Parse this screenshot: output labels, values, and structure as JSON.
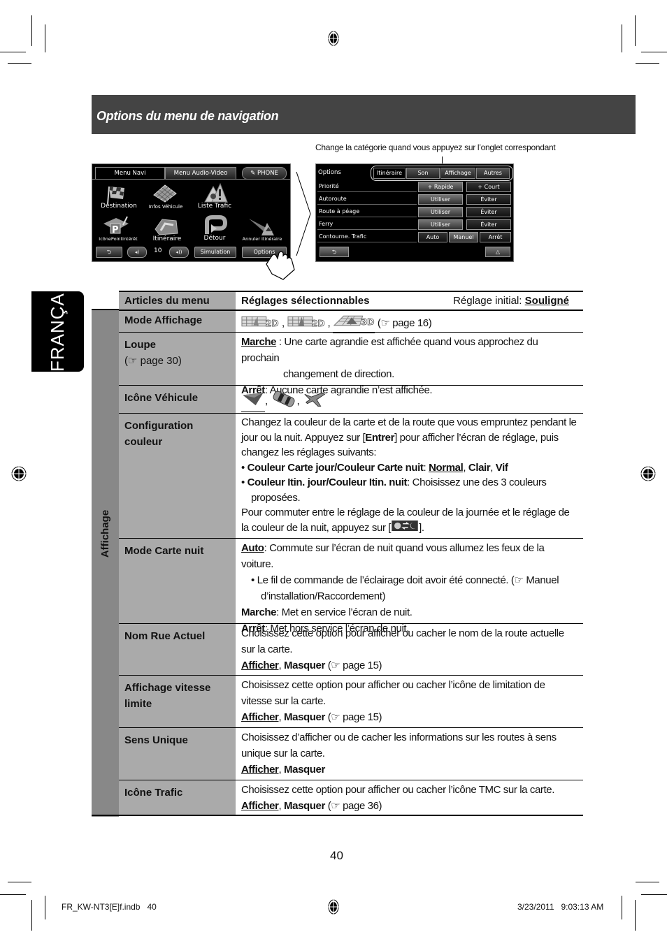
{
  "section": {
    "title": "Options du menu de navigation"
  },
  "caption": "Change la catégorie quand vous appuyez sur l’onglet correspondant",
  "screen_navi": {
    "tabs": [
      "Menu Navi",
      "Menu Audio-Video",
      "PHONE"
    ],
    "items": [
      {
        "label": "Destination",
        "icon": "checkered-flag-icon"
      },
      {
        "label": "Infos Véhicule",
        "icon": "map-grid-icon"
      },
      {
        "label": "Liste Trafic",
        "icon": "traffic-warning-icon"
      },
      {
        "label": "IcônePointIntérêt",
        "icon": "poi-parking-icon"
      },
      {
        "label": "Itinéraire",
        "icon": "route-map-icon"
      },
      {
        "label": "Détour",
        "icon": "detour-arrow-icon"
      },
      {
        "label": "Annuler Itinéraire",
        "icon": "cancel-route-icon"
      }
    ],
    "bottom": {
      "volume": "10",
      "simulation": "Simulation",
      "options": "Options"
    }
  },
  "screen_options": {
    "title": "Options",
    "tabs": [
      "Itinéraire",
      "Son",
      "Affichage",
      "Autres"
    ],
    "rows": [
      {
        "label": "Priorité",
        "buttons": [
          "+ Rapide",
          "+ Court"
        ]
      },
      {
        "label": "Autoroute",
        "buttons": [
          "Utiliser",
          "Éviter"
        ]
      },
      {
        "label": "Route à péage",
        "buttons": [
          "Utiliser",
          "Éviter"
        ]
      },
      {
        "label": "Ferry",
        "buttons": [
          "Utiliser",
          "Éviter"
        ]
      },
      {
        "label": "Contourne. Trafic",
        "buttons": [
          "Auto",
          "Manuel",
          "Arrêt"
        ]
      }
    ]
  },
  "language_tab": "FRANÇAIS",
  "table": {
    "col1": "Articles du menu",
    "col2": "Réglages sélectionnables",
    "initial_label": "Réglage initial:",
    "initial_value": "Souligné",
    "group": "Affichage",
    "rows": {
      "mode_affichage": {
        "name": "Mode Affichage",
        "ref": "(☞ page 16)",
        "options": [
          "2D North-up",
          "2D Heading-up",
          "3D"
        ]
      },
      "loupe": {
        "name": "Loupe",
        "ref": "(☞ page 30)",
        "l1_b": "Marche",
        "l1": " : Une carte agrandie est affichée quand vous approchez du prochain",
        "l1b": "changement de direction.",
        "l2_b": "Arrêt",
        "l2": ": Aucune carte agrandie n’est affichée."
      },
      "icone_vehicule": {
        "name": "Icône Véhicule",
        "options": [
          "arrow",
          "car",
          "jet"
        ]
      },
      "config_couleur": {
        "name": "Configuration couleur",
        "p1a": "Changez la couleur de la carte et de la route que vous empruntez pendant le jour ou la nuit. Appuyez sur [",
        "p1b": "Entrer",
        "p1c": "] pour afficher l’écran de réglage, puis changez les réglages suivants:",
        "b1_label": "Couleur Carte jour/Couleur Carte nuit",
        "b1_opt1": "Normal",
        "b1_opt2": "Clair",
        "b1_opt3": "Vif",
        "b2_label": "Couleur Itin. jour/Couleur Itin. nuit",
        "b2_text": ": Choisissez une des 3 couleurs proposées.",
        "p2": "Pour commuter entre le réglage de la couleur de la journée et le réglage de la couleur de la nuit, appuyez sur [",
        "p2_end": "]."
      },
      "mode_carte_nuit": {
        "name": "Mode Carte nuit",
        "auto_b": "Auto",
        "auto": ": Commute sur l’écran de nuit quand vous allumez les feux de la voiture.",
        "note": "Le fil de commande de l’éclairage doit avoir été connecté. (☞ Manuel d’installation/Raccordement)",
        "marche_b": "Marche",
        "marche": ": Met en service l’écran de nuit.",
        "arret_b": "Arrêt",
        "arret": ": Met hors service l’écran de nuit."
      },
      "nom_rue": {
        "name": "Nom Rue Actuel",
        "text": "Choisissez cette option pour afficher ou cacher le nom de la route actuelle sur la carte.",
        "opt1": "Afficher",
        "opt2": "Masquer",
        "ref": "(☞ page 15)"
      },
      "vitesse": {
        "name": "Affichage vitesse limite",
        "text": "Choisissez cette option pour afficher ou cacher l’icône de limitation de vitesse sur la carte.",
        "opt1": "Afficher",
        "opt2": "Masquer",
        "ref": "(☞ page 15)"
      },
      "sens_unique": {
        "name": "Sens Unique",
        "text": "Choisissez d’afficher ou de cacher les informations sur les routes à sens unique sur la carte.",
        "opt1": "Afficher",
        "opt2": "Masquer"
      },
      "icone_trafic": {
        "name": "Icône Trafic",
        "text": "Choisissez cette option pour afficher ou cacher l’icône TMC sur la carte.",
        "opt1": "Afficher",
        "opt2": "Masquer",
        "ref": "(☞ page 36)"
      }
    }
  },
  "page_number": "40",
  "footer": {
    "file": "FR_KW-NT3[E]f.indb   40",
    "timestamp": "3/23/2011   9:03:13 AM"
  }
}
